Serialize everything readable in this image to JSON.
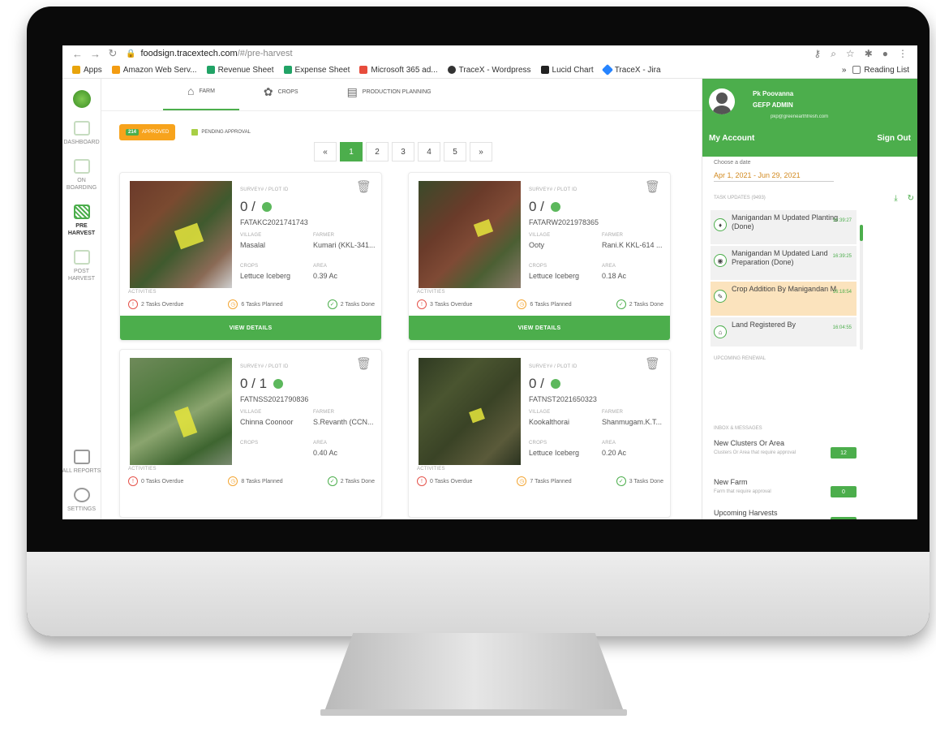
{
  "browser": {
    "url_host": "foodsign.tracextech.com",
    "url_path": "/#/pre-harvest",
    "bookmarks": [
      "Apps",
      "Amazon Web Serv...",
      "Revenue Sheet",
      "Expense Sheet",
      "Microsoft 365 ad...",
      "TraceX - Wordpress",
      "Lucid Chart",
      "TraceX - Jira"
    ],
    "reading_list": "Reading List",
    "bookmark_colors": [
      "#e8a40c",
      "#f39c12",
      "#21a366",
      "#21a366",
      "#e74c3c",
      "#333333",
      "#222222",
      "#2684ff"
    ]
  },
  "sidebar": {
    "items": [
      {
        "label": "DASHBOARD"
      },
      {
        "label": "ON BOARDING"
      },
      {
        "label": "PRE HARVEST"
      },
      {
        "label": "POST HARVEST"
      },
      {
        "label": "ALL REPORTS"
      },
      {
        "label": "SETTINGS"
      }
    ]
  },
  "tabs": [
    {
      "label": "FARM"
    },
    {
      "label": "CROPS"
    },
    {
      "label": "PRODUCTION PLANNING"
    }
  ],
  "status": {
    "approved_count": "214",
    "approved_label": "APPROVED",
    "pending_label": "PENDING APPROVAL"
  },
  "pagination": {
    "prev": "«",
    "pages": [
      "1",
      "2",
      "3",
      "4",
      "5"
    ],
    "next": "»",
    "current": "1"
  },
  "card_labels": {
    "plot": "SURVEY# / PLOT ID",
    "village": "VILLAGE",
    "farmer": "FARMER",
    "crops": "CROPS",
    "area": "AREA",
    "activities": "ACTIVITIES",
    "view_details": "VIEW DETAILS"
  },
  "cards": [
    {
      "plot": "0 /",
      "code": "FATAKC2021741743",
      "village": "Masalal",
      "farmer": "Kumari (KKL-341...",
      "crops": "Lettuce Iceberg",
      "area": "0.39 Ac",
      "overdue": "2 Tasks Overdue",
      "planned": "6 Tasks Planned",
      "done": "2 Tasks Done"
    },
    {
      "plot": "0 /",
      "code": "FATARW2021978365",
      "village": "Ooty",
      "farmer": "Rani.K KKL-614 ...",
      "crops": "Lettuce Iceberg",
      "area": "0.18 Ac",
      "overdue": "3 Tasks Overdue",
      "planned": "6 Tasks Planned",
      "done": "2 Tasks Done"
    },
    {
      "plot": "0 / 1",
      "code": "FATNSS2021790836",
      "village": "Chinna Coonoor",
      "farmer": "S.Revanth (CCN...",
      "crops": "",
      "area": "0.40 Ac",
      "overdue": "0 Tasks Overdue",
      "planned": "8 Tasks Planned",
      "done": "2 Tasks Done"
    },
    {
      "plot": "0 /",
      "code": "FATNST2021650323",
      "village": "Kookalthorai",
      "farmer": "Shanmugam.K.T...",
      "crops": "Lettuce Iceberg",
      "area": "0.20 Ac",
      "overdue": "0 Tasks Overdue",
      "planned": "7 Tasks Planned",
      "done": "3 Tasks Done"
    }
  ],
  "user": {
    "name": "Pk Poovanna",
    "role": "GEFP ADMIN",
    "email": "pkp@greenearthfresh.com",
    "my_account": "My Account",
    "sign_out": "Sign Out"
  },
  "date": {
    "label": "Choose a date",
    "value": "Apr 1, 2021 - Jun 29, 2021"
  },
  "tasks": {
    "header": "TASK UPDATES (9493)",
    "items": [
      {
        "text": "Manigandan M Updated Planting (Done)",
        "time": "16:39:27"
      },
      {
        "text": "Manigandan M Updated Land Preparation (Done)",
        "time": "16:39:25"
      },
      {
        "text": "Crop Addition By Manigandan M",
        "time": "16:18:54"
      },
      {
        "text": "Land Registered By",
        "time": "16:04:55"
      }
    ]
  },
  "upcoming_renewal": "UPCOMING RENEWAL",
  "inbox": {
    "header": "INBOX & MESSAGES",
    "items": [
      {
        "title": "New Clusters Or Area",
        "sub": "Clusters Or Area that require approval",
        "count": "12"
      },
      {
        "title": "New Farm",
        "sub": "Farm that require approval",
        "count": "0"
      },
      {
        "title": "Upcoming Harvests",
        "sub": "",
        "count": ""
      }
    ]
  }
}
